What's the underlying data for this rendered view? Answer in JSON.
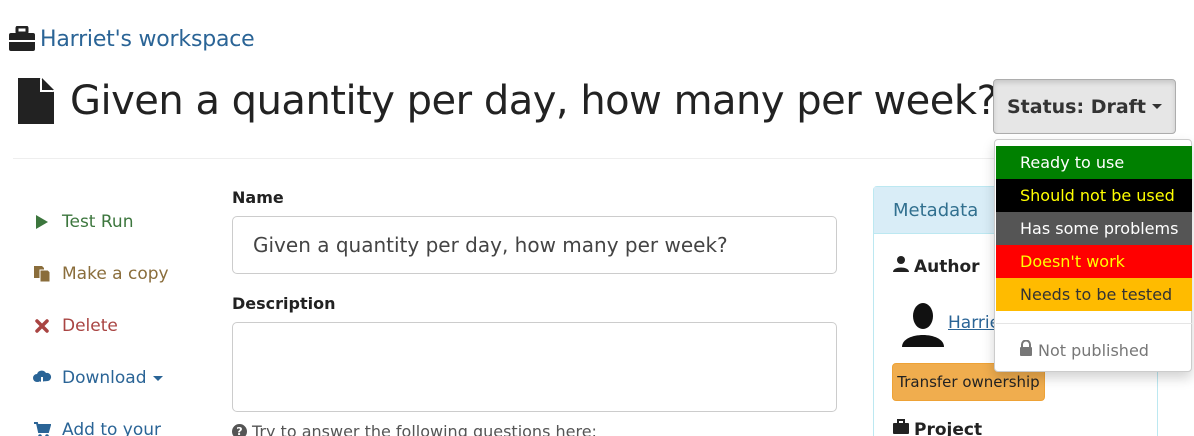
{
  "breadcrumb": {
    "workspace_label": "Harriet's workspace",
    "icon": "briefcase-icon"
  },
  "page": {
    "title": "Given a quantity per day, how many per week?",
    "icon": "file-icon"
  },
  "status_button": {
    "label": "Status: Draft"
  },
  "sidebar": {
    "items": [
      {
        "label": "Test Run",
        "icon": "play-icon",
        "color": "#3c763d"
      },
      {
        "label": "Make a copy",
        "icon": "copy-icon",
        "color": "#8a6d3b"
      },
      {
        "label": "Delete",
        "icon": "remove-icon",
        "color": "#a94442"
      },
      {
        "label": "Download",
        "icon": "cloud-download-icon",
        "color": "#2a6496"
      },
      {
        "label": "Add to your",
        "icon": "cart-icon",
        "color": "#2a6496"
      }
    ]
  },
  "form": {
    "name_label": "Name",
    "name_value": "Given a quantity per day, how many per week?",
    "description_label": "Description",
    "description_value": "",
    "help_text": "Try to answer the following questions here:"
  },
  "metadata": {
    "header": "Metadata",
    "author_label": "Author",
    "author_name": "Harrie",
    "transfer_label": "Transfer ownership",
    "project_label": "Project"
  },
  "status_menu": {
    "options": [
      {
        "label": "Ready to use",
        "bg": "#008000",
        "fg": "#ffffff"
      },
      {
        "label": "Should not be used",
        "bg": "#000000",
        "fg": "#ffff00"
      },
      {
        "label": "Has some problems",
        "bg": "#555555",
        "fg": "#ffffff"
      },
      {
        "label": "Doesn't work",
        "bg": "#ff0000",
        "fg": "#ffff00"
      },
      {
        "label": "Needs to be tested",
        "bg": "#ffbb00",
        "fg": "#333333"
      }
    ],
    "not_published_label": "Not published"
  }
}
